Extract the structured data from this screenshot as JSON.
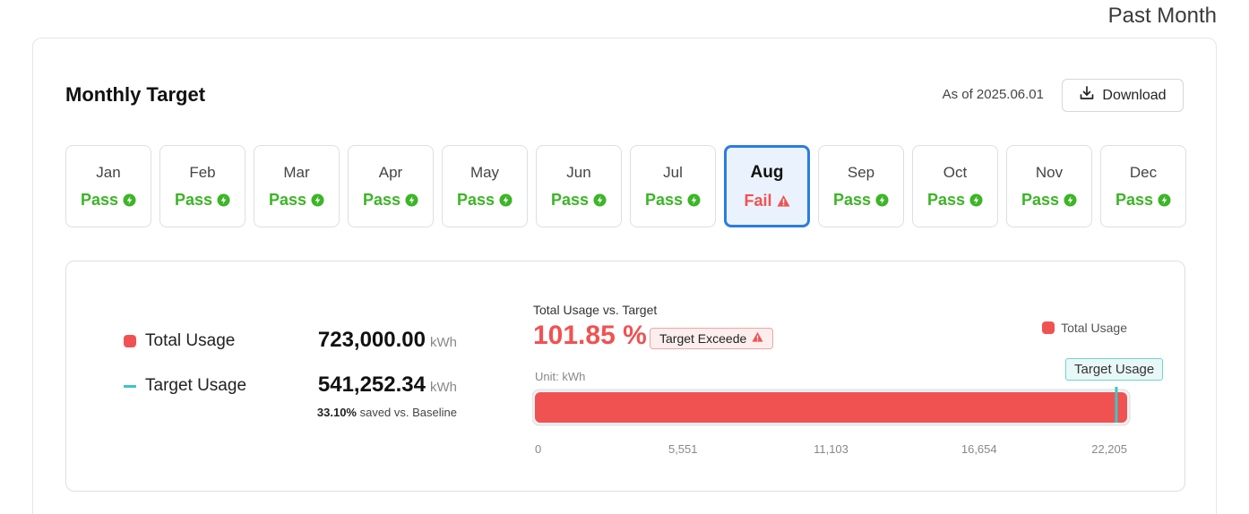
{
  "period": "Past Month",
  "card": {
    "title": "Monthly Target",
    "as_of": "As of 2025.06.01",
    "download_label": "Download"
  },
  "months": [
    {
      "name": "Jan",
      "status": "Pass",
      "state": "pass"
    },
    {
      "name": "Feb",
      "status": "Pass",
      "state": "pass"
    },
    {
      "name": "Mar",
      "status": "Pass",
      "state": "pass"
    },
    {
      "name": "Apr",
      "status": "Pass",
      "state": "pass"
    },
    {
      "name": "May",
      "status": "Pass",
      "state": "pass"
    },
    {
      "name": "Jun",
      "status": "Pass",
      "state": "pass"
    },
    {
      "name": "Jul",
      "status": "Pass",
      "state": "pass"
    },
    {
      "name": "Aug",
      "status": "Fail",
      "state": "fail",
      "selected": true
    },
    {
      "name": "Sep",
      "status": "Pass",
      "state": "pass"
    },
    {
      "name": "Oct",
      "status": "Pass",
      "state": "pass"
    },
    {
      "name": "Nov",
      "status": "Pass",
      "state": "pass"
    },
    {
      "name": "Dec",
      "status": "Pass",
      "state": "pass"
    }
  ],
  "detail": {
    "total_label": "Total Usage",
    "total_value": "723,000.00",
    "total_unit": "kWh",
    "target_label": "Target Usage",
    "target_value": "541,252.34",
    "target_unit": "kWh",
    "saved_pct": "33.10%",
    "saved_text": " saved vs. Baseline"
  },
  "chart": {
    "label": "Total Usage vs. Target",
    "percent": "101.85 %",
    "badge": "Target Exceede",
    "legend": "Total Usage",
    "unit": "Unit: kWh",
    "target_tag": "Target Usage"
  },
  "chart_data": {
    "type": "bar",
    "orientation": "horizontal",
    "title": "Total Usage vs. Target",
    "unit": "kWh",
    "xlim": [
      0,
      22205
    ],
    "ticks": [
      "0",
      "5,551",
      "11,103",
      "16,654",
      "22,205"
    ],
    "series": [
      {
        "name": "Total Usage",
        "values": [
          22205
        ],
        "color": "#f05252"
      }
    ],
    "target_marker": {
      "name": "Target Usage",
      "value": 21800,
      "color": "#3ec6c3"
    }
  },
  "colors": {
    "pass": "#3cb526",
    "fail": "#f05252",
    "selected_border": "#2a7de1",
    "target": "#3ec6c3"
  },
  "icons": {
    "pass": "bolt-circle-icon",
    "fail": "warning-triangle-icon",
    "download": "download-icon"
  }
}
